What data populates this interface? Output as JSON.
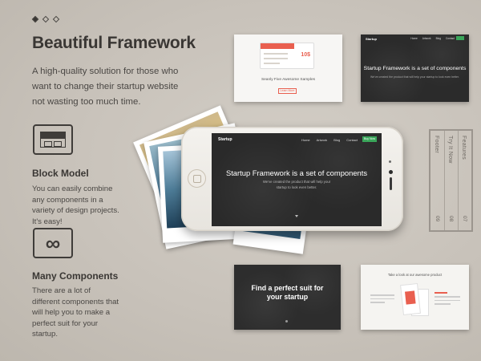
{
  "slider": {
    "dots": 3,
    "active_index": 0
  },
  "hero": {
    "title": "Beautiful Framework",
    "lead": "A high-quality solution for those who want to change their startup website not wasting too much time."
  },
  "features": [
    {
      "icon": "block-model-icon",
      "title": "Block Model",
      "text": "You can easily combine any components in a variety of design projects. It's easy!"
    },
    {
      "icon": "infinity-icon",
      "title": "Many Components",
      "text": "There are a lot of different components that will help you to make a perfect suit for your startup."
    }
  ],
  "thumbs": {
    "light": {
      "price": "10$",
      "caption": "Seanly Five Awesome Samples",
      "button": "Learn More"
    },
    "dark": {
      "logo": "Startup",
      "menu": [
        "Home",
        "Artwork",
        "Blog",
        "Contact"
      ],
      "headline": "Startup Framework is a set of components",
      "sub": "We've created the product that will help your startup to look even better."
    },
    "suit": {
      "headline_1": "Find a perfect suit for",
      "headline_2": "your startup"
    },
    "look": {
      "title": "Take a look at our awesome product"
    }
  },
  "footer_card": {
    "labels": [
      "Footer",
      "Try It Now",
      "Features"
    ],
    "numbers": [
      "09",
      "08",
      "07"
    ]
  },
  "phone": {
    "logo": "Startup",
    "menu": [
      "Home",
      "Artwork",
      "Blog",
      "Contact"
    ],
    "buy_label": "Buy Now",
    "headline": "Startup Framework is a set of components",
    "sub": "We've created the product that will help your startup to look even better."
  },
  "colors": {
    "background": "#c9c3bb",
    "accent_green": "#3aa65a",
    "accent_red": "#e95f4f",
    "dark_block": "#2b2b2b"
  }
}
